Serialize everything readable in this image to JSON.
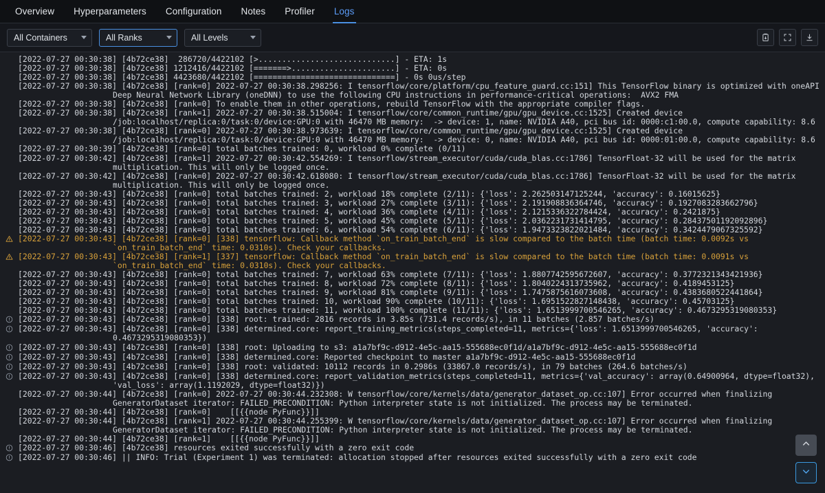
{
  "tabs": [
    {
      "label": "Overview",
      "active": false
    },
    {
      "label": "Hyperparameters",
      "active": false
    },
    {
      "label": "Configuration",
      "active": false
    },
    {
      "label": "Notes",
      "active": false
    },
    {
      "label": "Profiler",
      "active": false
    },
    {
      "label": "Logs",
      "active": true
    }
  ],
  "filters": {
    "containers": {
      "value": "All Containers",
      "icon": "chevron-down-icon"
    },
    "ranks": {
      "value": "All Ranks",
      "icon": "chevron-down-icon"
    },
    "levels": {
      "value": "All Levels",
      "icon": "chevron-down-icon"
    }
  },
  "toolbar": {
    "copy": {
      "icon": "copy-clipboard-icon",
      "label": "Copy to clipboard"
    },
    "fullscreen": {
      "icon": "fullscreen-icon",
      "label": "Fullscreen"
    },
    "download": {
      "icon": "download-icon",
      "label": "Download logs"
    }
  },
  "scroll": {
    "up": {
      "icon": "chevron-up-icon",
      "label": "Scroll to top"
    },
    "down": {
      "icon": "chevron-down-icon",
      "label": "Scroll to bottom"
    }
  },
  "colors": {
    "accent": "#4a90e2",
    "warning": "#d8a13a",
    "log_bg": "#1b1d22",
    "chrome_bg": "#15171c",
    "tabbar_bg": "#0f1114",
    "text": "#d3d7dd"
  },
  "logs": [
    {
      "level": "plain",
      "text": "[2022-07-27 00:30:38] [4b72ce38]  286720/4422102 [>.............................] - ETA: 1s"
    },
    {
      "level": "plain",
      "text": "[2022-07-27 00:30:38] [4b72ce38] 1212416/4422102 [=======>......................] - ETA: 0s"
    },
    {
      "level": "plain",
      "text": "[2022-07-27 00:30:38] [4b72ce38] 4423680/4422102 [==============================] - 0s 0us/step"
    },
    {
      "level": "plain",
      "text": "[2022-07-27 00:30:38] [4b72ce38] [rank=0] 2022-07-27 00:30:38.298256: I tensorflow/core/platform/cpu_feature_guard.cc:151] This TensorFlow binary is optimized with oneAPI Deep Neural Network Library (oneDNN) to use the following CPU instructions in performance-critical operations:  AVX2 FMA"
    },
    {
      "level": "plain",
      "text": "[2022-07-27 00:30:38] [4b72ce38] [rank=0] To enable them in other operations, rebuild TensorFlow with the appropriate compiler flags."
    },
    {
      "level": "plain",
      "text": "[2022-07-27 00:30:38] [4b72ce38] [rank=1] 2022-07-27 00:30:38.515004: I tensorflow/core/common_runtime/gpu/gpu_device.cc:1525] Created device /job:localhost/replica:0/task:0/device:GPU:0 with 46470 MB memory:  -> device: 1, name: NVIDIA A40, pci bus id: 0000:c1:00.0, compute capability: 8.6"
    },
    {
      "level": "plain",
      "text": "[2022-07-27 00:30:38] [4b72ce38] [rank=0] 2022-07-27 00:30:38.973639: I tensorflow/core/common_runtime/gpu/gpu_device.cc:1525] Created device /job:localhost/replica:0/task:0/device:GPU:0 with 46470 MB memory:  -> device: 0, name: NVIDIA A40, pci bus id: 0000:01:00.0, compute capability: 8.6"
    },
    {
      "level": "plain",
      "text": "[2022-07-27 00:30:39] [4b72ce38] [rank=0] total batches trained: 0, workload 0% complete (0/11)"
    },
    {
      "level": "plain",
      "text": "[2022-07-27 00:30:42] [4b72ce38] [rank=1] 2022-07-27 00:30:42.554269: I tensorflow/stream_executor/cuda/cuda_blas.cc:1786] TensorFloat-32 will be used for the matrix multiplication. This will only be logged once."
    },
    {
      "level": "plain",
      "text": "[2022-07-27 00:30:42] [4b72ce38] [rank=0] 2022-07-27 00:30:42.618080: I tensorflow/stream_executor/cuda/cuda_blas.cc:1786] TensorFloat-32 will be used for the matrix multiplication. This will only be logged once."
    },
    {
      "level": "plain",
      "text": "[2022-07-27 00:30:43] [4b72ce38] [rank=0] total batches trained: 2, workload 18% complete (2/11): {'loss': 2.262503147125244, 'accuracy': 0.16015625}"
    },
    {
      "level": "plain",
      "text": "[2022-07-27 00:30:43] [4b72ce38] [rank=0] total batches trained: 3, workload 27% complete (3/11): {'loss': 2.191908836364746, 'accuracy': 0.1927083283662796}"
    },
    {
      "level": "plain",
      "text": "[2022-07-27 00:30:43] [4b72ce38] [rank=0] total batches trained: 4, workload 36% complete (4/11): {'loss': 2.1215336322784424, 'accuracy': 0.2421875}"
    },
    {
      "level": "plain",
      "text": "[2022-07-27 00:30:43] [4b72ce38] [rank=0] total batches trained: 5, workload 45% complete (5/11): {'loss': 2.0362231731414795, 'accuracy': 0.28437501192092896}"
    },
    {
      "level": "plain",
      "text": "[2022-07-27 00:30:43] [4b72ce38] [rank=0] total batches trained: 6, workload 54% complete (6/11): {'loss': 1.9473323822021484, 'accuracy': 0.3424479067325592}"
    },
    {
      "level": "warning",
      "icon": "warning-triangle-icon",
      "text": "[2022-07-27 00:30:43] [4b72ce38] [rank=0] [338] tensorflow: Callback method `on_train_batch_end` is slow compared to the batch time (batch time: 0.0092s vs `on_train_batch_end` time: 0.0310s). Check your callbacks."
    },
    {
      "level": "warning",
      "icon": "warning-triangle-icon",
      "text": "[2022-07-27 00:30:43] [4b72ce38] [rank=1] [337] tensorflow: Callback method `on_train_batch_end` is slow compared to the batch time (batch time: 0.0091s vs `on_train_batch_end` time: 0.0310s). Check your callbacks."
    },
    {
      "level": "plain",
      "text": "[2022-07-27 00:30:43] [4b72ce38] [rank=0] total batches trained: 7, workload 63% complete (7/11): {'loss': 1.8807742595672607, 'accuracy': 0.3772321343421936}"
    },
    {
      "level": "plain",
      "text": "[2022-07-27 00:30:43] [4b72ce38] [rank=0] total batches trained: 8, workload 72% complete (8/11): {'loss': 1.8040224313735962, 'accuracy': 0.4189453125}"
    },
    {
      "level": "plain",
      "text": "[2022-07-27 00:30:43] [4b72ce38] [rank=0] total batches trained: 9, workload 81% complete (9/11): {'loss': 1.7475875616073608, 'accuracy': 0.4383680522441864}"
    },
    {
      "level": "plain",
      "text": "[2022-07-27 00:30:43] [4b72ce38] [rank=0] total batches trained: 10, workload 90% complete (10/11): {'loss': 1.6951522827148438, 'accuracy': 0.45703125}"
    },
    {
      "level": "plain",
      "text": "[2022-07-27 00:30:43] [4b72ce38] [rank=0] total batches trained: 11, workload 100% complete (11/11): {'loss': 1.6513999700546265, 'accuracy': 0.4673295319080353}"
    },
    {
      "level": "info",
      "icon": "info-circle-icon",
      "text": "[2022-07-27 00:30:43] [4b72ce38] [rank=0] [338] root: trained: 2816 records in 3.85s (731.4 records/s), in 11 batches (2.857 batches/s)"
    },
    {
      "level": "info",
      "icon": "info-circle-icon",
      "text": "[2022-07-27 00:30:43] [4b72ce38] [rank=0] [338] determined.core: report_training_metrics(steps_completed=11, metrics={'loss': 1.6513999700546265, 'accuracy': 0.4673295319080353})"
    },
    {
      "level": "info",
      "icon": "info-circle-icon",
      "text": "[2022-07-27 00:30:43] [4b72ce38] [rank=0] [338] root: Uploading to s3: a1a7bf9c-d912-4e5c-aa15-555688ec0f1d/a1a7bf9c-d912-4e5c-aa15-555688ec0f1d"
    },
    {
      "level": "info",
      "icon": "info-circle-icon",
      "text": "[2022-07-27 00:30:43] [4b72ce38] [rank=0] [338] determined.core: Reported checkpoint to master a1a7bf9c-d912-4e5c-aa15-555688ec0f1d"
    },
    {
      "level": "info",
      "icon": "info-circle-icon",
      "text": "[2022-07-27 00:30:43] [4b72ce38] [rank=0] [338] root: validated: 10112 records in 0.2986s (33867.0 records/s), in 79 batches (264.6 batches/s)"
    },
    {
      "level": "info",
      "icon": "info-circle-icon",
      "text": "[2022-07-27 00:30:43] [4b72ce38] [rank=0] [338] determined.core: report_validation_metrics(steps_completed=11, metrics={'val_accuracy': array(0.64900964, dtype=float32), 'val_loss': array(1.1192029, dtype=float32)})"
    },
    {
      "level": "plain",
      "text": "[2022-07-27 00:30:44] [4b72ce38] [rank=0] 2022-07-27 00:30:44.232308: W tensorflow/core/kernels/data/generator_dataset_op.cc:107] Error occurred when finalizing GeneratorDataset iterator: FAILED_PRECONDITION: Python interpreter state is not initialized. The process may be terminated."
    },
    {
      "level": "plain",
      "text": "[2022-07-27 00:30:44] [4b72ce38] [rank=0]    [[{{node PyFunc}}]]"
    },
    {
      "level": "plain",
      "text": "[2022-07-27 00:30:44] [4b72ce38] [rank=1] 2022-07-27 00:30:44.255399: W tensorflow/core/kernels/data/generator_dataset_op.cc:107] Error occurred when finalizing GeneratorDataset iterator: FAILED_PRECONDITION: Python interpreter state is not initialized. The process may be terminated."
    },
    {
      "level": "plain",
      "text": "[2022-07-27 00:30:44] [4b72ce38] [rank=1]    [[{{node PyFunc}}]]"
    },
    {
      "level": "info",
      "icon": "info-circle-icon",
      "text": "[2022-07-27 00:30:46] [4b72ce38] resources exited successfully with a zero exit code"
    },
    {
      "level": "info",
      "icon": "info-circle-icon",
      "text": "[2022-07-27 00:30:46] || INFO: Trial (Experiment 1) was terminated: allocation stopped after resources exited successfully with a zero exit code"
    }
  ]
}
